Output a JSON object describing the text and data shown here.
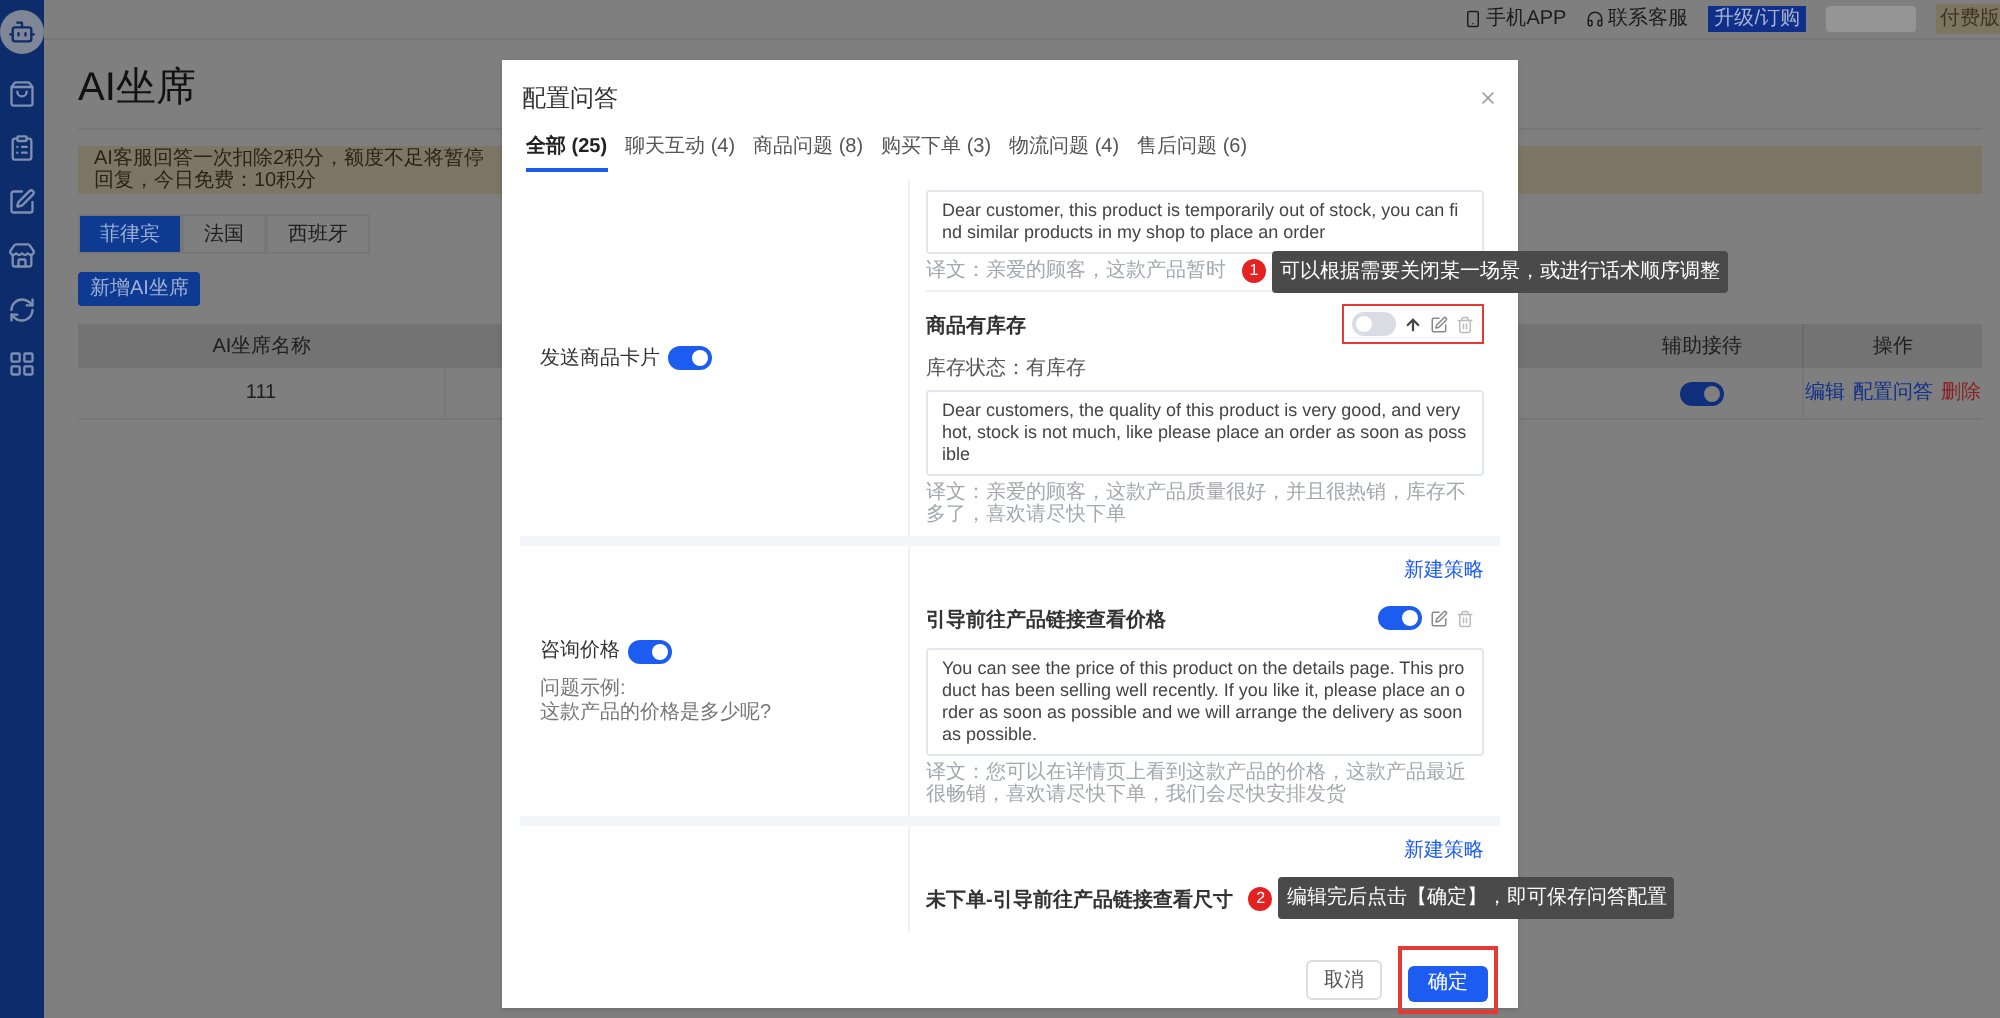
{
  "top_bar": {
    "links": [
      "手机APP",
      "联系客服"
    ],
    "upgrade_button": "升级/订购",
    "plan_badge": "付费版"
  },
  "page": {
    "title": "AI坐席",
    "notice": "AI客服回答一次扣除2积分，额度不足将暂停回复，今日免费：10积分",
    "tabs": [
      {
        "label": "菲律宾",
        "selected": true
      },
      {
        "label": "法国",
        "selected": false
      },
      {
        "label": "西班牙",
        "selected": false
      }
    ],
    "add_button": "新增AI坐席",
    "table": {
      "columns": [
        "AI坐席名称",
        "辅助接待",
        "操作"
      ],
      "rows": [
        {
          "name": "111",
          "assist_on": true,
          "actions": [
            {
              "label": "编辑",
              "kind": "link"
            },
            {
              "label": "配置问答",
              "kind": "link"
            },
            {
              "label": "删除",
              "kind": "danger"
            }
          ]
        }
      ]
    }
  },
  "dialog": {
    "title": "配置问答",
    "tabs": [
      {
        "label": "全部 (25)",
        "selected": true
      },
      {
        "label": "聊天互动 (4)",
        "selected": false
      },
      {
        "label": "商品问题 (8)",
        "selected": false
      },
      {
        "label": "购买下单 (3)",
        "selected": false
      },
      {
        "label": "物流问题 (4)",
        "selected": false
      },
      {
        "label": "售后问题 (6)",
        "selected": false
      }
    ],
    "sections": [
      {
        "scene": "发送商品卡片",
        "on": true,
        "strategies": [
          {
            "reply": "Dear customer, this product is temporarily out of stock, you can find similar products in my shop to place an order",
            "translation": "译文：亲爱的顾客，这款产品暂时",
            "hint": {
              "number": "1",
              "text": "可以根据需要关闭某一场景，或进行话术顺序调整"
            }
          },
          {
            "title": "商品有库存",
            "on": false,
            "movable": true,
            "highlighted": true,
            "condition": "库存状态：有库存",
            "reply": "Dear customers, the quality of this product is very good, and very hot, stock is not much, like please place an order as soon as possible",
            "translation": "译文：亲爱的顾客，这款产品质量很好，并且很热销，库存不多了，喜欢请尽快下单"
          }
        ]
      },
      {
        "scene": "咨询价格",
        "on": true,
        "example": [
          "问题示例:",
          "这款产品的价格是多少呢?"
        ],
        "new_strategy_link": "新建策略",
        "strategies": [
          {
            "title": "引导前往产品链接查看价格",
            "on": true,
            "movable": false,
            "highlighted": false,
            "reply": "You can see the price of this product on the details page. This product has been selling well recently. If you like it, please place an order as soon as possible and we will arrange the delivery as soon as possible.",
            "translation": "译文：您可以在详情页上看到这款产品的价格，这款产品最近很畅销，喜欢请尽快下单，我们会尽快安排发货"
          }
        ]
      },
      {
        "new_strategy_link": "新建策略",
        "strategies": [
          {
            "title": "未下单-引导前往产品链接查看尺寸",
            "hint": {
              "number": "2",
              "text": "编辑完后点击【确定】，即可保存问答配置"
            }
          }
        ]
      }
    ],
    "buttons": {
      "cancel": "取消",
      "confirm": "确定",
      "confirm_highlighted": true
    }
  }
}
